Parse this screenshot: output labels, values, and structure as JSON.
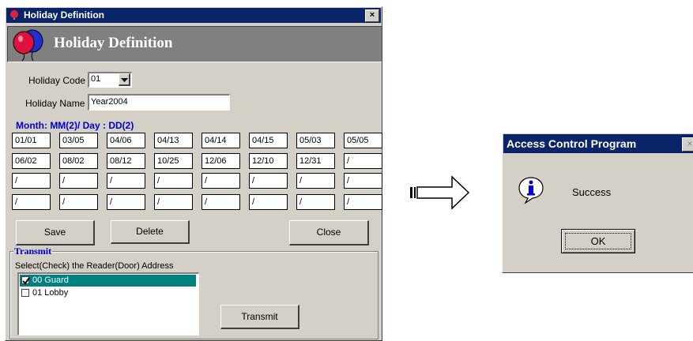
{
  "main_window": {
    "title": "Holiday Definition",
    "banner_title": "Holiday Definition",
    "close_glyph": "✕",
    "holiday_code_label": "Holiday Code",
    "holiday_code_value": "01",
    "holiday_name_label": "Holiday Name",
    "holiday_name_value": "Year2004",
    "date_format_label": "Month: MM(2)/ Day : DD(2)",
    "dates": [
      "01/01",
      "03/05",
      "04/06",
      "04/13",
      "04/14",
      "04/15",
      "05/03",
      "05/05",
      "06/02",
      "08/02",
      "08/12",
      "10/25",
      "12/06",
      "12/10",
      "12/31",
      "/",
      "/",
      "/",
      "/",
      "/",
      "/",
      "/",
      "/",
      "/",
      "/",
      "/",
      "/",
      "/",
      "/",
      "/",
      "/",
      "/"
    ],
    "buttons": {
      "save": "Save",
      "delete": "Delete",
      "close": "Close",
      "transmit": "Transmit"
    },
    "transmit_group": {
      "title": "Transmit",
      "instruction": "Select(Check) the Reader(Door) Address",
      "readers": [
        {
          "label": "00 Guard",
          "checked": true,
          "selected": true
        },
        {
          "label": "01 Lobby",
          "checked": false,
          "selected": false
        }
      ]
    }
  },
  "dialog": {
    "title": "Access Control Program",
    "message": "Success",
    "ok_label": "OK",
    "icon": "info-icon"
  },
  "colors": {
    "titlebar": "#0a246a",
    "selection": "#008080",
    "banner": "#808080",
    "blue_label": "#0000c8"
  }
}
